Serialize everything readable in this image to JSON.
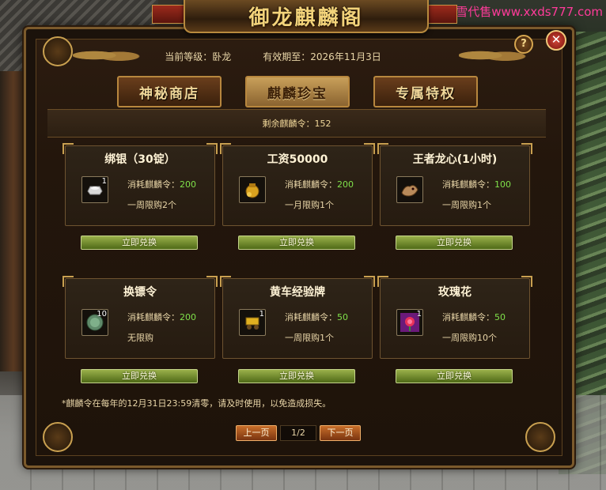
{
  "watermark": "小雪代售www.xxds777.com",
  "window": {
    "title": "御龙麒麟阁"
  },
  "header": {
    "level_text": "当前等级：卧龙",
    "expiry_text": "有效期至：2026年11月3日",
    "help_label": "?",
    "close_label": "✕"
  },
  "tabs": [
    {
      "label": "神秘商店",
      "active": false
    },
    {
      "label": "麒麟珍宝",
      "active": true
    },
    {
      "label": "专属特权",
      "active": false
    }
  ],
  "remaining": {
    "text": "剩余麒麟令：152"
  },
  "cost_label": "消耗麒麟令：",
  "items": [
    {
      "name": "绑银（30锭）",
      "icon": "silver-ingot-icon",
      "qty": "1",
      "cost": "200",
      "limit": "一周限购2个",
      "button": "立即兑换"
    },
    {
      "name": "工资50000",
      "icon": "gold-sack-icon",
      "qty": "",
      "cost": "200",
      "limit": "一月限购1个",
      "button": "立即兑换"
    },
    {
      "name": "王者龙心(1小时)",
      "icon": "dragon-heart-icon",
      "qty": "",
      "cost": "100",
      "limit": "一周限购1个",
      "button": "立即兑换"
    },
    {
      "name": "换镖令",
      "icon": "escort-token-icon",
      "qty": "10",
      "cost": "200",
      "limit": "无限购",
      "button": "立即兑换"
    },
    {
      "name": "黄车经验牌",
      "icon": "yellow-cart-icon",
      "qty": "1",
      "cost": "50",
      "limit": "一周限购1个",
      "button": "立即兑换"
    },
    {
      "name": "玫瑰花",
      "icon": "rose-icon",
      "qty": "1",
      "cost": "50",
      "limit": "一周限购10个",
      "button": "立即兑换"
    }
  ],
  "notice": "*麒麟令在每年的12月31日23:59清零，请及时使用，以免造成损失。",
  "pager": {
    "prev": "上一页",
    "page": "1/2",
    "next": "下一页"
  },
  "colors": {
    "accent_gold": "#c9a050",
    "button_green": "#7a9630",
    "cost_green": "#7fe04a",
    "watermark_pink": "#ff3b9a"
  }
}
